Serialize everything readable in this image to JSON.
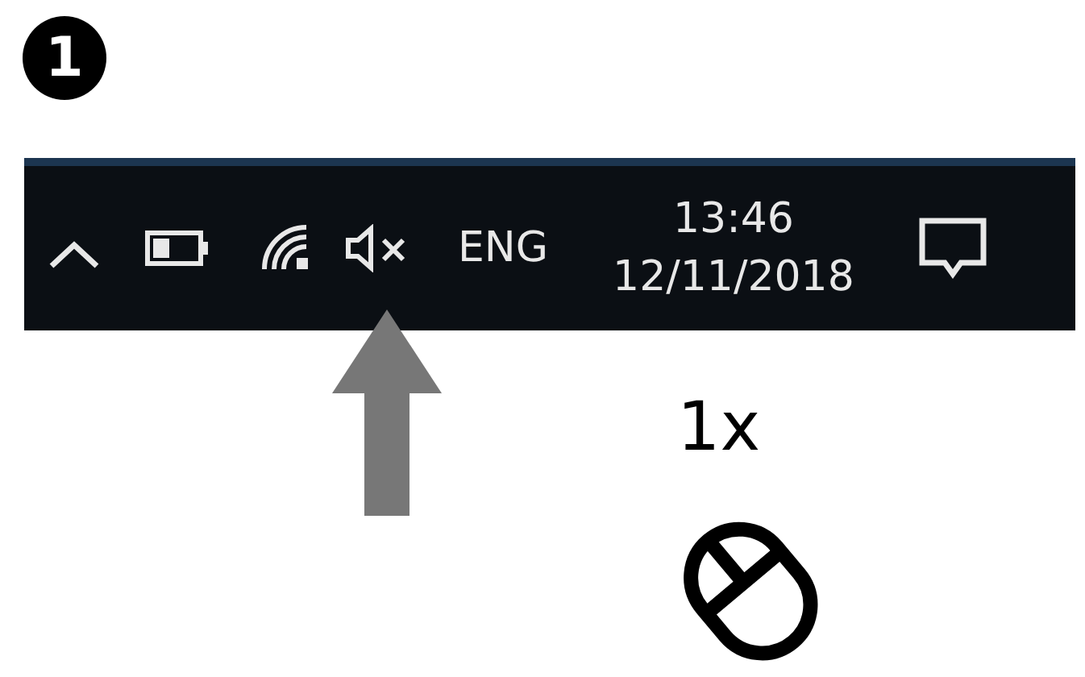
{
  "step": {
    "number": "1"
  },
  "taskbar": {
    "volume": {
      "muted": true
    },
    "language": "ENG",
    "time": "13:46",
    "date": "12/11/2018"
  },
  "instruction": {
    "clicks": "1x"
  }
}
